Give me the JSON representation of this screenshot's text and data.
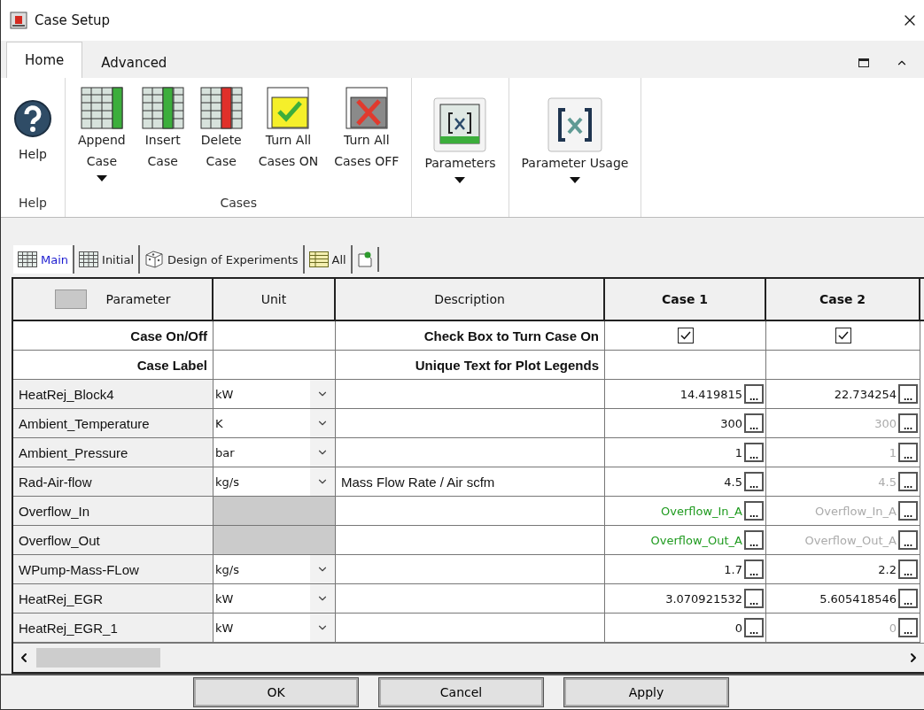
{
  "window": {
    "title": "Case Setup"
  },
  "ribbon": {
    "tabs": [
      {
        "label": "Home",
        "selected": true
      },
      {
        "label": "Advanced",
        "selected": false
      }
    ],
    "groups": [
      {
        "label": "Help",
        "buttons": [
          {
            "kind": "help",
            "lines": [
              "Help"
            ],
            "dropdown": false
          }
        ]
      },
      {
        "label": "Cases",
        "buttons": [
          {
            "kind": "append",
            "lines": [
              "Append",
              "Case"
            ],
            "dropdown": true
          },
          {
            "kind": "insert",
            "lines": [
              "Insert",
              "Case"
            ],
            "dropdown": false
          },
          {
            "kind": "delete",
            "lines": [
              "Delete",
              "Case"
            ],
            "dropdown": false
          },
          {
            "kind": "on",
            "lines": [
              "Turn All",
              "Cases ON"
            ],
            "dropdown": false
          },
          {
            "kind": "off",
            "lines": [
              "Turn All",
              "Cases OFF"
            ],
            "dropdown": false
          }
        ]
      },
      {
        "buttons": [
          {
            "kind": "params",
            "lines": [
              "Parameters"
            ],
            "dropdown": true
          }
        ]
      },
      {
        "buttons": [
          {
            "kind": "usage",
            "lines": [
              "Parameter Usage"
            ],
            "dropdown": true
          }
        ]
      }
    ]
  },
  "sheet_tabs": [
    {
      "label": "Main",
      "kind": "grid",
      "selected": true
    },
    {
      "label": "Initial",
      "kind": "grid",
      "selected": false
    },
    {
      "label": "Design of Experiments",
      "kind": "dice",
      "selected": false
    },
    {
      "label": "All",
      "kind": "yellowgrid",
      "selected": false
    }
  ],
  "table": {
    "columns": [
      "Parameter",
      "Unit",
      "Description",
      "Case 1",
      "Case 2"
    ],
    "value_button": "...",
    "special_rows": [
      {
        "kind": "checkbox",
        "label": "Case On/Off",
        "description": "Check Box to Turn Case On",
        "cases": [
          {
            "checked": true
          },
          {
            "checked": true
          }
        ]
      },
      {
        "kind": "text",
        "label": "Case Label",
        "description": "Unique Text for Plot Legends"
      }
    ],
    "rows": [
      {
        "parameter": "HeatRej_Block4",
        "unit": "kW",
        "values": [
          {
            "text": "14.419815",
            "kind": "own"
          },
          {
            "text": "22.734254",
            "kind": "own"
          }
        ]
      },
      {
        "parameter": "Ambient_Temperature",
        "unit": "K",
        "values": [
          {
            "text": "300",
            "kind": "own"
          },
          {
            "text": "300",
            "kind": "inherited"
          }
        ]
      },
      {
        "parameter": "Ambient_Pressure",
        "unit": "bar",
        "values": [
          {
            "text": "1",
            "kind": "own"
          },
          {
            "text": "1",
            "kind": "inherited"
          }
        ]
      },
      {
        "parameter": "Rad-Air-flow",
        "unit": "kg/s",
        "description": "Mass Flow Rate / Air scfm",
        "values": [
          {
            "text": "4.5",
            "kind": "own"
          },
          {
            "text": "4.5",
            "kind": "inherited"
          }
        ]
      },
      {
        "parameter": "Overflow_In",
        "values": [
          {
            "text": "Overflow_In_A",
            "kind": "linked"
          },
          {
            "text": "Overflow_In_A",
            "kind": "inherited"
          }
        ]
      },
      {
        "parameter": "Overflow_Out",
        "values": [
          {
            "text": "Overflow_Out_A",
            "kind": "linked"
          },
          {
            "text": "Overflow_Out_A",
            "kind": "inherited"
          }
        ]
      },
      {
        "parameter": "WPump-Mass-FLow",
        "unit": "kg/s",
        "values": [
          {
            "text": "1.7",
            "kind": "own"
          },
          {
            "text": "2.2",
            "kind": "own"
          }
        ]
      },
      {
        "parameter": "HeatRej_EGR",
        "unit": "kW",
        "values": [
          {
            "text": "3.070921532",
            "kind": "own"
          },
          {
            "text": "5.605418546",
            "kind": "own"
          }
        ]
      },
      {
        "parameter": "HeatRej_EGR_1",
        "unit": "kW",
        "values": [
          {
            "text": "0",
            "kind": "own"
          },
          {
            "text": "0",
            "kind": "inherited"
          }
        ]
      }
    ]
  },
  "buttons": [
    "OK",
    "Cancel",
    "Apply"
  ]
}
